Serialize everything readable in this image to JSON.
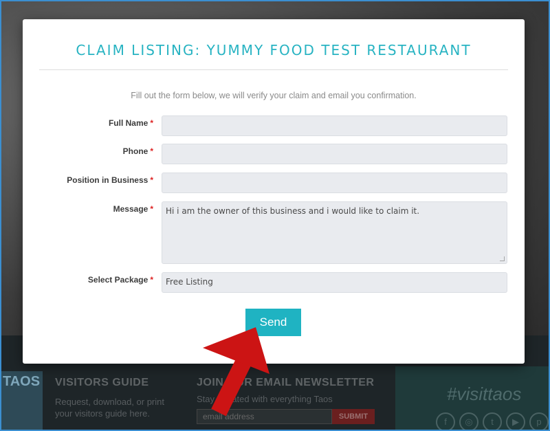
{
  "modal": {
    "title": "CLAIM LISTING: YUMMY FOOD TEST RESTAURANT",
    "intro": "Fill out the form below, we will verify your claim and email you confirmation.",
    "required_marker": "*",
    "fields": [
      {
        "label": "Full Name",
        "value": ""
      },
      {
        "label": "Phone",
        "value": ""
      },
      {
        "label": "Position in Business",
        "value": ""
      },
      {
        "label": "Message",
        "value": "Hi i am the owner of this business and i would like to claim it."
      },
      {
        "label": "Select Package",
        "value": "Free Listing"
      }
    ],
    "send_label": "Send"
  },
  "background": {
    "thumb_text": "TAOS",
    "visitors_guide": {
      "title": "VISITORS GUIDE",
      "text": "Request, download, or print your visitors guide here."
    },
    "newsletter": {
      "title": "JOIN OUR EMAIL NEWSLETTER",
      "text": "Stay updated with everything Taos",
      "input_placeholder": "email address",
      "submit_label": "SUBMIT"
    },
    "hashtag": "#visittaos",
    "social_icons": [
      "facebook-icon",
      "instagram-icon",
      "twitter-icon",
      "youtube-icon",
      "pinterest-icon"
    ]
  },
  "colors": {
    "accent": "#1fb3c2",
    "required": "#dd2222",
    "annotation_arrow": "#cc1414"
  }
}
